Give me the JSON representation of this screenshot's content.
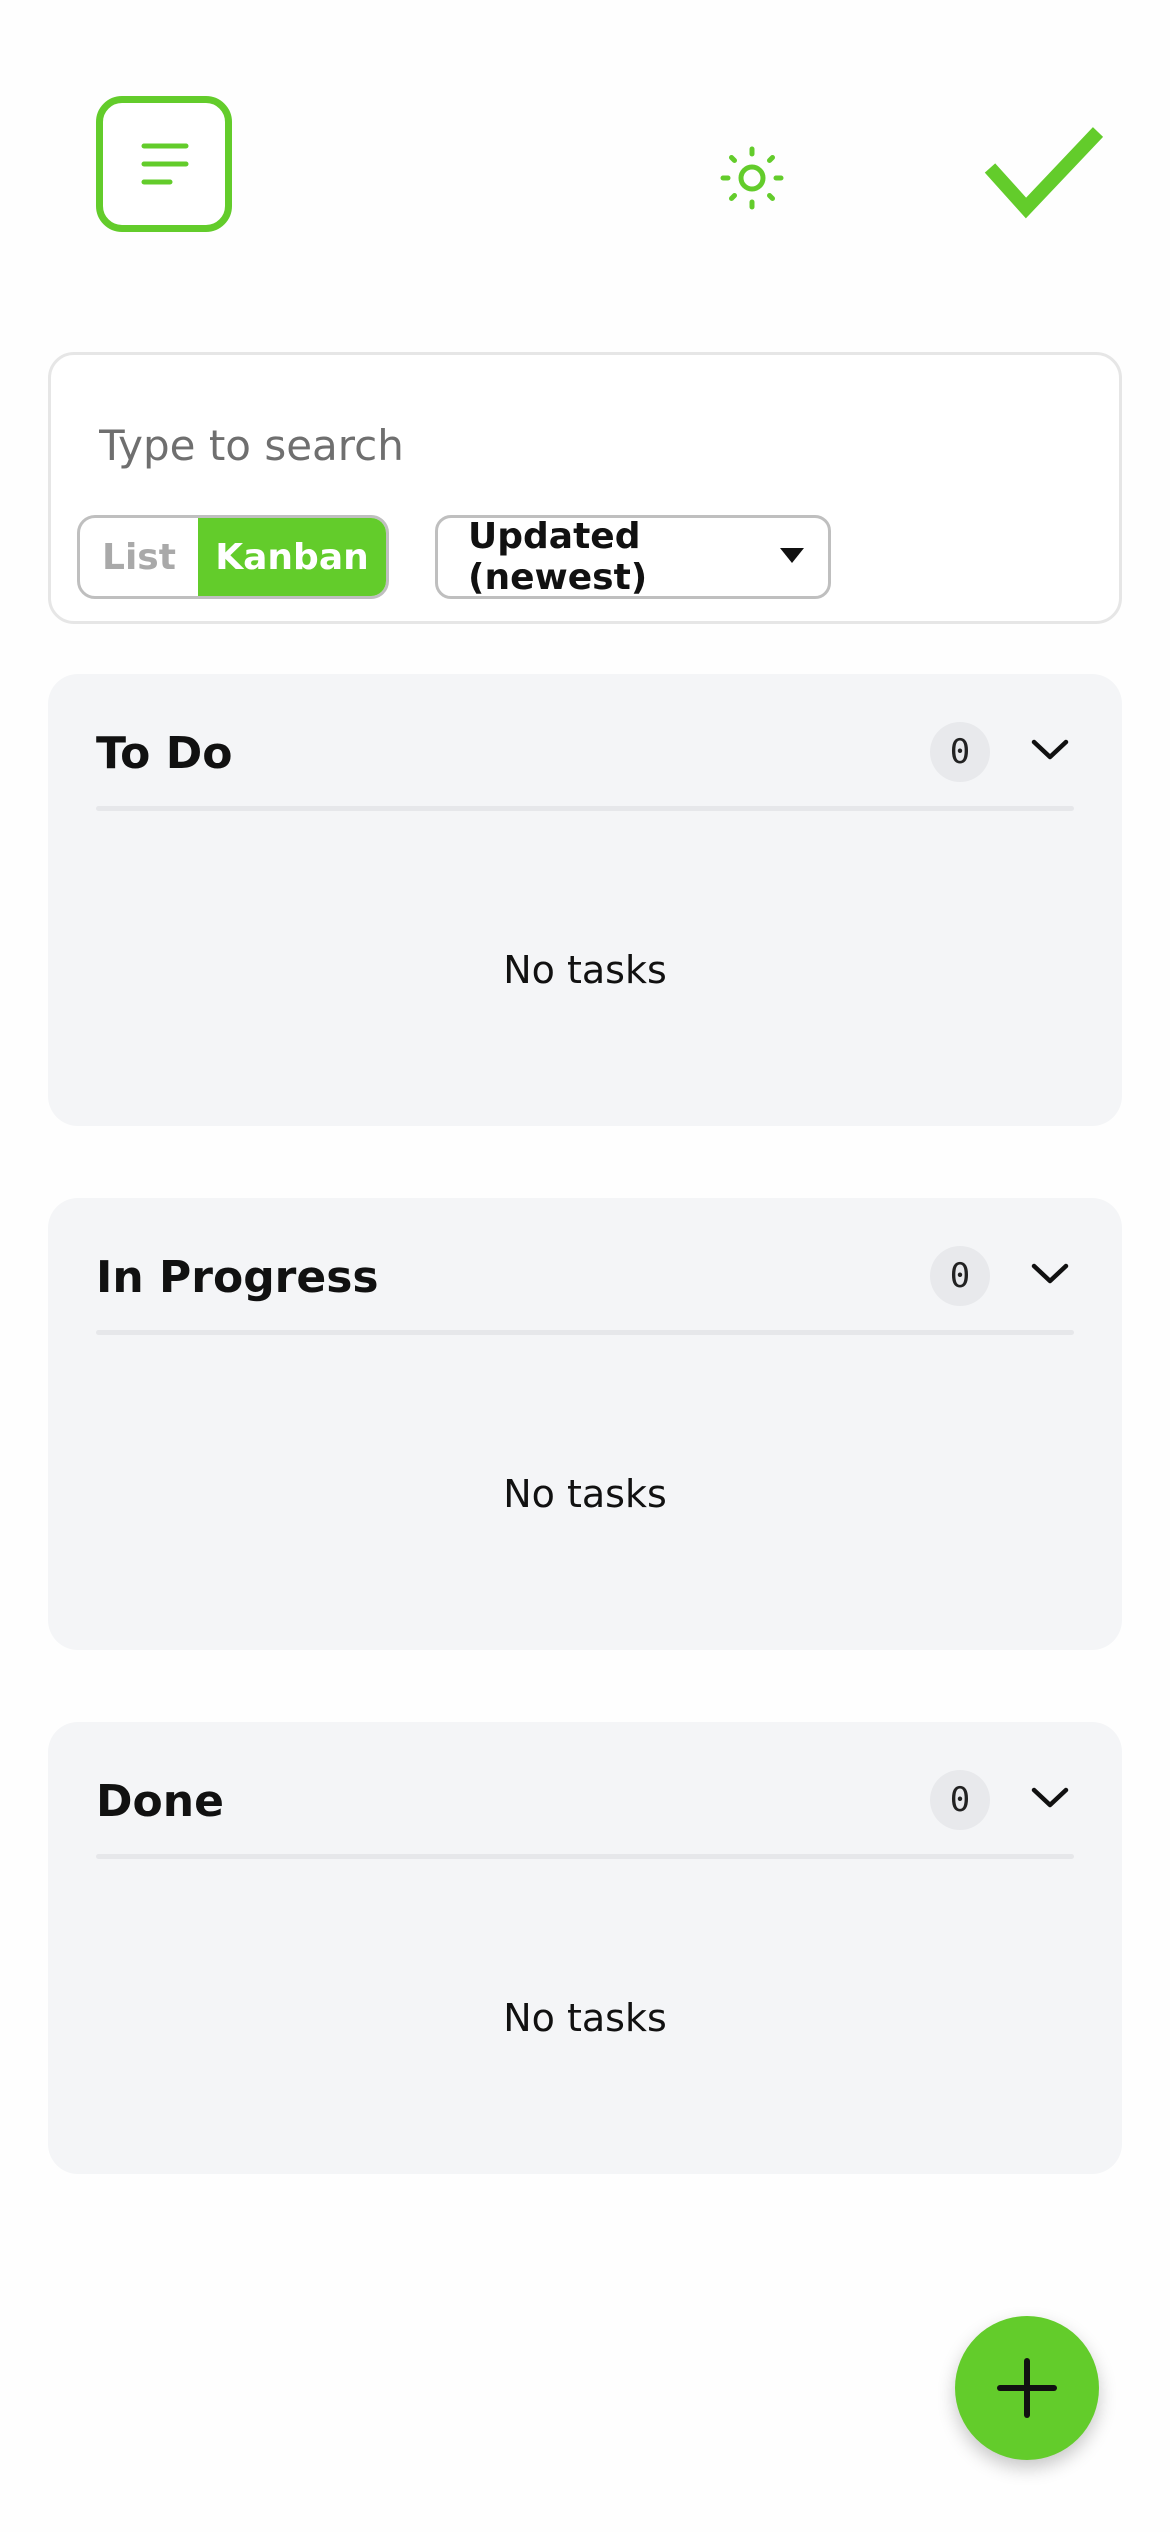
{
  "header": {
    "menu_icon": "menu-lines-icon",
    "theme_icon": "sun-icon",
    "logo_icon": "checkmark-icon",
    "accent_color": "#63cc2b"
  },
  "search": {
    "placeholder": "Type to search",
    "value": ""
  },
  "view_toggle": {
    "options": [
      "List",
      "Kanban"
    ],
    "selected": "Kanban"
  },
  "sort": {
    "selected": "Updated (newest)",
    "icon": "caret-down-icon"
  },
  "columns": [
    {
      "title": "To Do",
      "count": "0",
      "empty_text": "No tasks",
      "toggle_icon": "chevron-down-icon"
    },
    {
      "title": "In Progress",
      "count": "0",
      "empty_text": "No tasks",
      "toggle_icon": "chevron-down-icon"
    },
    {
      "title": "Done",
      "count": "0",
      "empty_text": "No tasks",
      "toggle_icon": "chevron-down-icon"
    }
  ],
  "fab": {
    "icon": "plus-icon"
  }
}
